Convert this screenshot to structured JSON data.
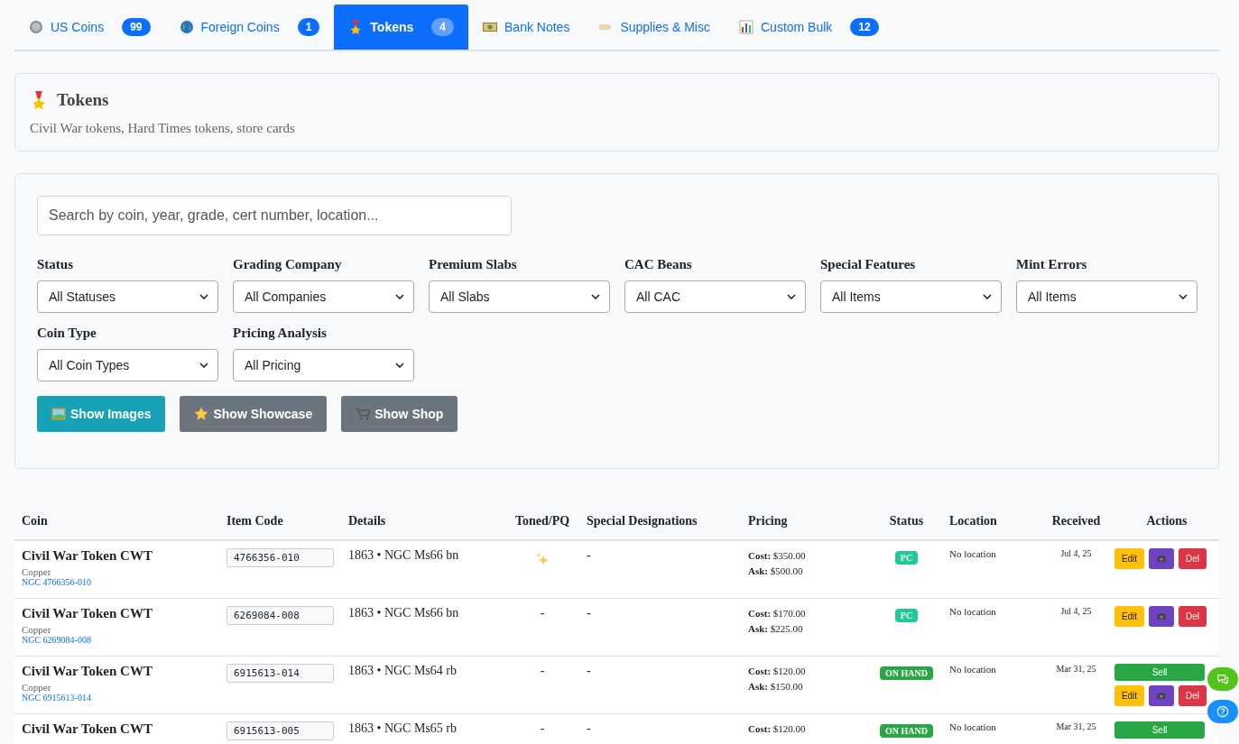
{
  "tabs": [
    {
      "label": "US Coins",
      "count": "99",
      "selected": false
    },
    {
      "label": "Foreign Coins",
      "count": "1",
      "selected": false
    },
    {
      "label": "Tokens",
      "count": "4",
      "selected": true
    },
    {
      "label": "Bank Notes",
      "selected": false
    },
    {
      "label": "Supplies & Misc",
      "selected": false
    },
    {
      "label": "Custom Bulk",
      "count": "12",
      "selected": false
    }
  ],
  "header": {
    "title": "Tokens",
    "subtitle": "Civil War tokens, Hard Times tokens, store cards"
  },
  "filters": {
    "search": {
      "placeholder": "Search by coin, year, grade, cert number, location..."
    },
    "selects": [
      {
        "label": "Status",
        "value": "All Statuses"
      },
      {
        "label": "Grading Company",
        "value": "All Companies"
      },
      {
        "label": "Premium Slabs",
        "value": "All Slabs"
      },
      {
        "label": "CAC Beans",
        "value": "All CAC"
      },
      {
        "label": "Special Features",
        "value": "All Items"
      },
      {
        "label": "Mint Errors",
        "value": "All Items"
      },
      {
        "label": "Coin Type",
        "value": "All Coin Types"
      },
      {
        "label": "Pricing Analysis",
        "value": "All Pricing"
      }
    ],
    "buttons": [
      {
        "label": "Show Images",
        "selected": true
      },
      {
        "label": "Show Showcase",
        "selected": false
      },
      {
        "label": "Show Shop",
        "selected": false
      }
    ]
  },
  "table": {
    "columns": [
      "Coin",
      "Item Code",
      "Details",
      "Toned/PQ",
      "Special Designations",
      "Pricing",
      "Status",
      "Location",
      "Received",
      "Actions"
    ],
    "rows": [
      {
        "coin": "Civil War Token CWT",
        "metal": "Copper",
        "cert": "NGC 4766356-010",
        "item_code": "4766356-010",
        "details": "1863 • NGC Ms66 bn",
        "toned": true,
        "special": "-",
        "cost": "**Cost:** $350.00",
        "ask": "**Ask:** $500.00",
        "status": {
          "label": "PC",
          "kind": "pc"
        },
        "location": "No location",
        "received": "Jul 4, 25",
        "actions": [
          "Edit",
          "Del"
        ]
      },
      {
        "coin": "Civil War Token CWT",
        "metal": "Copper",
        "cert": "NGC 6269084-008",
        "item_code": "6269084-008",
        "details": "1863 • NGC Ms66 bn",
        "toned": false,
        "toned_text": "-",
        "special": "-",
        "cost": "**Cost:** $170.00",
        "ask": "**Ask:** $225.00",
        "status": {
          "label": "PC",
          "kind": "pc"
        },
        "location": "No location",
        "received": "Jul 4, 25",
        "actions": [
          "Edit",
          "Del"
        ]
      },
      {
        "coin": "Civil War Token CWT",
        "metal": "Copper",
        "cert": "NGC 6915613-014",
        "item_code": "6915613-014",
        "details": "1863 • NGC Ms64 rb",
        "toned": false,
        "toned_text": "-",
        "special": "-",
        "cost": "**Cost:** $120.00",
        "ask": "**Ask:** $150.00",
        "status": {
          "label": "ON HAND",
          "kind": "on_hand"
        },
        "location": "No location",
        "received": "Mar 31, 25",
        "sell": "Sell",
        "actions": [
          "Edit",
          "Del"
        ]
      },
      {
        "coin": "Civil War Token CWT",
        "item_code": "6915613-005",
        "details": "1863 • NGC Ms65 rb",
        "toned": false,
        "toned_text": "-",
        "special": "-",
        "cost": "**Cost:** $120.00",
        "status": {
          "label": "ON HAND",
          "kind": "on_hand"
        },
        "location": "No location",
        "received": "Mar 31, 25",
        "sell": "Sell"
      }
    ]
  }
}
